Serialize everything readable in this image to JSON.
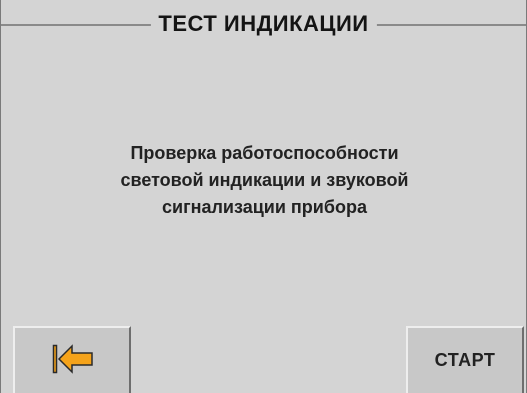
{
  "header": {
    "title": "ТЕСТ  ИНДИКАЦИИ"
  },
  "main": {
    "description_lines": [
      "Проверка работоспособности",
      "световой индикации и звуковой",
      "сигнализации прибора"
    ]
  },
  "footer": {
    "back_button_icon": "back-arrow-icon",
    "start_label": "СТАРТ"
  },
  "colors": {
    "background": "#d4d4d4",
    "accent_arrow": "#f5a31a",
    "text": "#222222"
  }
}
